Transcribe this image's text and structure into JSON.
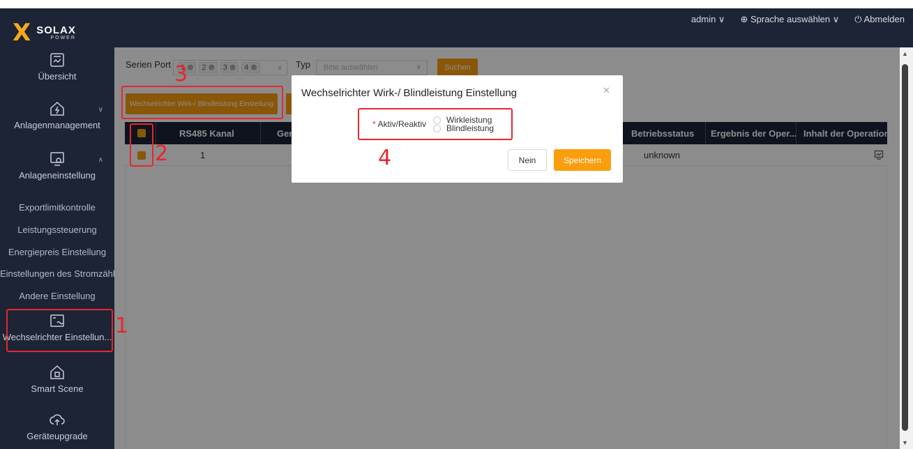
{
  "header": {
    "logo_mark": "X",
    "logo_name": "SOLAX",
    "logo_sub": "POWER",
    "user": "admin ∨",
    "language": "⊕ Sprache auswählen ∨",
    "logout": "⏻ Abmelden"
  },
  "sidebar": {
    "overview": "Übersicht",
    "plant_management": "Anlagenmanagement",
    "plant_settings": "Anlageneinstellung",
    "sub_items": [
      "Exportlimitkontrolle",
      "Leistungssteuerung",
      "Energiepreis Einstellung",
      "Einstellungen des Stromzähl...",
      "Andere Einstellung"
    ],
    "inverter_settings": "Wechselrichter Einstellun...",
    "smart_scene": "Smart Scene",
    "device_upgrade": "Geräteupgrade"
  },
  "filters": {
    "serial_port_label": "Serien Port",
    "ports": [
      "1 ⊗",
      "2 ⊗",
      "3 ⊗",
      "4 ⊗"
    ],
    "type_label": "Typ",
    "type_placeholder": "Bitte auswählen",
    "search_button": "Suchen"
  },
  "toolbar": {
    "power_button": "Wechselrichter Wirk-/ Blindleistung Einstellung"
  },
  "table": {
    "headers": [
      "RS485 Kanal",
      "Ger",
      "Betriebsstatus",
      "Ergebnis der Oper...",
      "Inhalt der Operation"
    ],
    "rows": [
      {
        "channel": "1",
        "status": "unknown"
      }
    ]
  },
  "modal": {
    "title": "Wechselrichter Wirk-/ Blindleistung Einstellung",
    "required_mark": "*",
    "field_label": "Aktiv/Reaktiv",
    "options": [
      "Wirkleistung",
      "Blindleistung"
    ],
    "cancel_button": "Nein",
    "save_button": "Speichern"
  },
  "annotations": [
    "1",
    "2",
    "3",
    "4"
  ],
  "colors": {
    "accent": "#fa9e0d",
    "sidebar": "#1c2435",
    "annotation": "#e8262e"
  }
}
